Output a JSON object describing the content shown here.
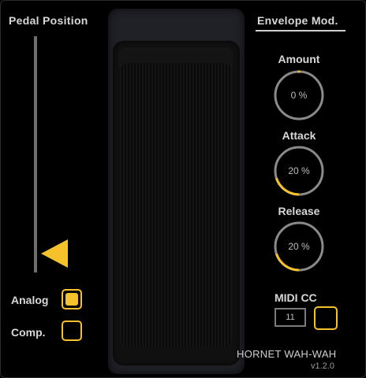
{
  "pedal_position": {
    "title": "Pedal Position",
    "level": 0.08
  },
  "envelope": {
    "title": "Envelope Mod.",
    "knobs": [
      {
        "label": "Amount",
        "value": "0 %",
        "fraction": 0.0
      },
      {
        "label": "Attack",
        "value": "20 %",
        "fraction": 0.2
      },
      {
        "label": "Release",
        "value": "20 %",
        "fraction": 0.2
      }
    ]
  },
  "options": {
    "analog_label": "Analog",
    "analog_checked": true,
    "comp_label": "Comp.",
    "comp_checked": false
  },
  "midi": {
    "label": "MIDI CC",
    "value": "11",
    "learn_checked": false
  },
  "brand": {
    "name": "HORNET WAH-WAH",
    "version": "v1.2.0"
  },
  "colors": {
    "accent": "#f5c22b",
    "ring": "#8a8a8a",
    "background": "#000000"
  }
}
